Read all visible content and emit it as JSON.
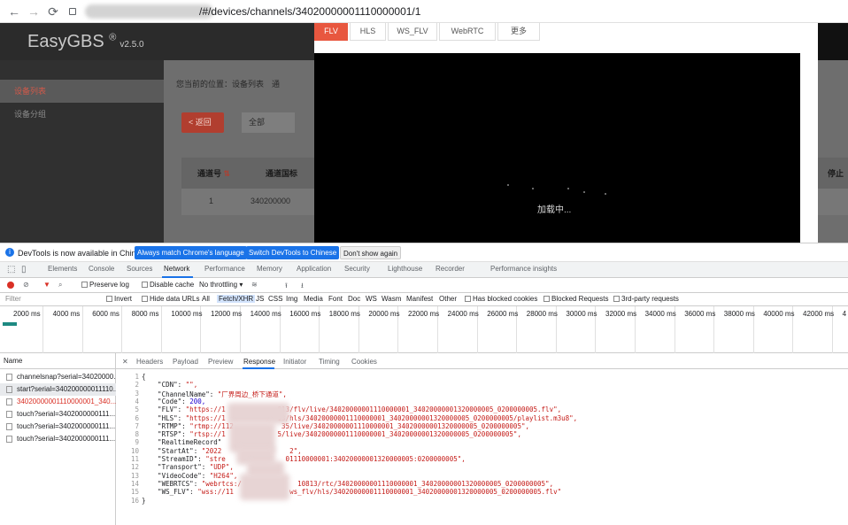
{
  "browser": {
    "url_path": "/#/devices/channels/34020000001110000001/1"
  },
  "app": {
    "logo": "EasyGBS",
    "logo_mark": "®",
    "version": "v2.5.0",
    "sidebar": [
      "设备列表",
      "设备分组"
    ],
    "breadcrumb": "您当前的位置：设备列表　通",
    "back_label": "返回",
    "filter_value": "全部",
    "table_headers": {
      "channel_no": "通道号",
      "channel_id": "通道国标",
      "stop": "停止"
    },
    "row": {
      "channel_no": "1",
      "channel_id": "340200000"
    }
  },
  "player": {
    "tabs": [
      "FLV",
      "HLS",
      "WS_FLV",
      "WebRTC",
      "更多"
    ],
    "active_tab": "FLV",
    "loading_text": "加载中..."
  },
  "devtools": {
    "infobar": {
      "text": "DevTools is now available in Chinese!",
      "btn_match": "Always match Chrome's language",
      "btn_switch": "Switch DevTools to Chinese",
      "btn_dismiss": "Don't show again"
    },
    "tabs": [
      "Elements",
      "Console",
      "Sources",
      "Network",
      "Performance",
      "Memory",
      "Application",
      "Security",
      "Lighthouse",
      "Recorder",
      "Performance insights"
    ],
    "active_tab": "Network",
    "toolbar": {
      "preserve_log": "Preserve log",
      "disable_cache": "Disable cache",
      "throttle": "No throttling"
    },
    "filter": {
      "label": "Filter",
      "invert": "Invert",
      "hide_data_urls": "Hide data URLs",
      "types": [
        "All",
        "Fetch/XHR",
        "JS",
        "CSS",
        "Img",
        "Media",
        "Font",
        "Doc",
        "WS",
        "Wasm",
        "Manifest",
        "Other"
      ],
      "active_type": "Fetch/XHR",
      "blocked_cookies": "Has blocked cookies",
      "blocked_requests": "Blocked Requests",
      "third_party": "3rd-party requests"
    },
    "timeline_ticks": [
      "2000 ms",
      "4000 ms",
      "6000 ms",
      "8000 ms",
      "10000 ms",
      "12000 ms",
      "14000 ms",
      "16000 ms",
      "18000 ms",
      "20000 ms",
      "22000 ms",
      "24000 ms",
      "26000 ms",
      "28000 ms",
      "30000 ms",
      "32000 ms",
      "34000 ms",
      "36000 ms",
      "38000 ms",
      "40000 ms",
      "42000 ms",
      "4"
    ],
    "requests_header": "Name",
    "requests": [
      {
        "name": "channelsnap?serial=34020000...",
        "state": "normal"
      },
      {
        "name": "start?serial=340200000011110...",
        "state": "selected"
      },
      {
        "name": "34020000001110000001_340...",
        "state": "error"
      },
      {
        "name": "touch?serial=3402000000111...",
        "state": "normal"
      },
      {
        "name": "touch?serial=3402000000111...",
        "state": "normal"
      },
      {
        "name": "touch?serial=3402000000111...",
        "state": "normal"
      }
    ],
    "response_tabs": [
      "Headers",
      "Payload",
      "Preview",
      "Response",
      "Initiator",
      "Timing",
      "Cookies"
    ],
    "active_response_tab": "Response",
    "response_lines": [
      "{",
      "    \"CDN\": \"\",",
      "    \"ChannelName\": \"厂界周边_桥下通道\",",
      "    \"Code\": 200,",
      "    \"FLV\": \"https://1             813/flv/live/34020000001110000001_34020000001320000005_0200000005.flv\",",
      "    \"HLS\": \"https://1             13/hls/34020000001110000001_34020000001320000005_0200000005/playlist.m3u8\",",
      "    \"RTMP\": \"rtmp://112            35/live/34020000001110000001_34020000001320000005_0200000005\",",
      "    \"RTSP\": \"rtsp://1             5/live/34020000001110000001_34020000001320000005_0200000005\",",
      "    \"RealtimeRecord\"",
      "    \"StartAt\": \"2022                 2\",",
      "    \"StreamID\": \"stre               01110000001:34020000001320000005:0200000005\",",
      "    \"Transport\": \"UDP\",",
      "    \"VideoCode\": \"H264\",",
      "    \"WEBRTCS\": \"webrtcs:/              10813/rtc/34020000001110000001_34020000001320000005_0200000005\",",
      "    \"WS_FLV\": \"wss://11              ws_flv/hls/34020000001110000001_34020000001320000005_0200000005.flv\"",
      "}"
    ]
  }
}
